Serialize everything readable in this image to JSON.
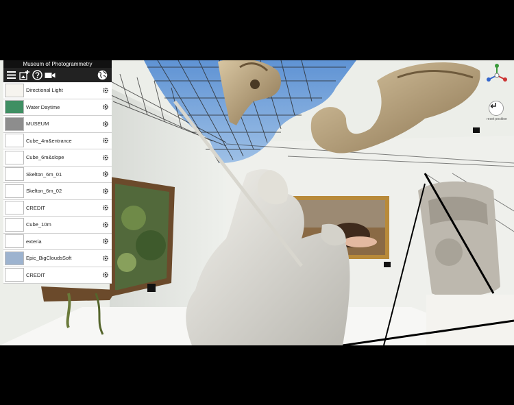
{
  "panel": {
    "title": "Museum of Photogrammetry",
    "toolbar": {
      "menu_icon": "hamburger-menu-icon",
      "add_icon": "add-image-icon",
      "help_icon": "help-icon",
      "camera_icon": "video-camera-icon",
      "globe_icon": "globe-icon"
    },
    "items": [
      {
        "label": "Directional Light",
        "thumb": "#f6f4ef",
        "icon": "sun-thumbnail"
      },
      {
        "label": "Water Daytime",
        "thumb": "#3f8f63",
        "icon": "water-thumbnail"
      },
      {
        "label": "MUSEUM",
        "thumb": "#8d8d8d",
        "icon": "museum-thumbnail"
      },
      {
        "label": "Cube_4m&entrance",
        "thumb": "#ffffff",
        "icon": "cube-thumbnail"
      },
      {
        "label": "Cube_6m&slope",
        "thumb": "#ffffff",
        "icon": "cube-thumbnail"
      },
      {
        "label": "Skelton_6m_01",
        "thumb": "#ffffff",
        "icon": "skeleton-thumbnail"
      },
      {
        "label": "Skelton_6m_02",
        "thumb": "#ffffff",
        "icon": "skeleton-thumbnail"
      },
      {
        "label": "CREDIT",
        "thumb": "#ffffff",
        "icon": "blank-thumbnail"
      },
      {
        "label": "Cube_10m",
        "thumb": "#ffffff",
        "icon": "cube-thumbnail"
      },
      {
        "label": "exteria",
        "thumb": "#ffffff",
        "icon": "exterior-thumbnail"
      },
      {
        "label": "Epic_BigCloudsSoft",
        "thumb": "#9db3cf",
        "icon": "clouds-thumbnail"
      },
      {
        "label": "CREDIT",
        "thumb": "#ffffff",
        "icon": "blank-thumbnail"
      }
    ]
  },
  "scene": {
    "reset_label": "reset position"
  },
  "colors": {
    "sky": "#6f9fd8",
    "wall": "#e9ebe6",
    "panel_header": "#111111"
  }
}
